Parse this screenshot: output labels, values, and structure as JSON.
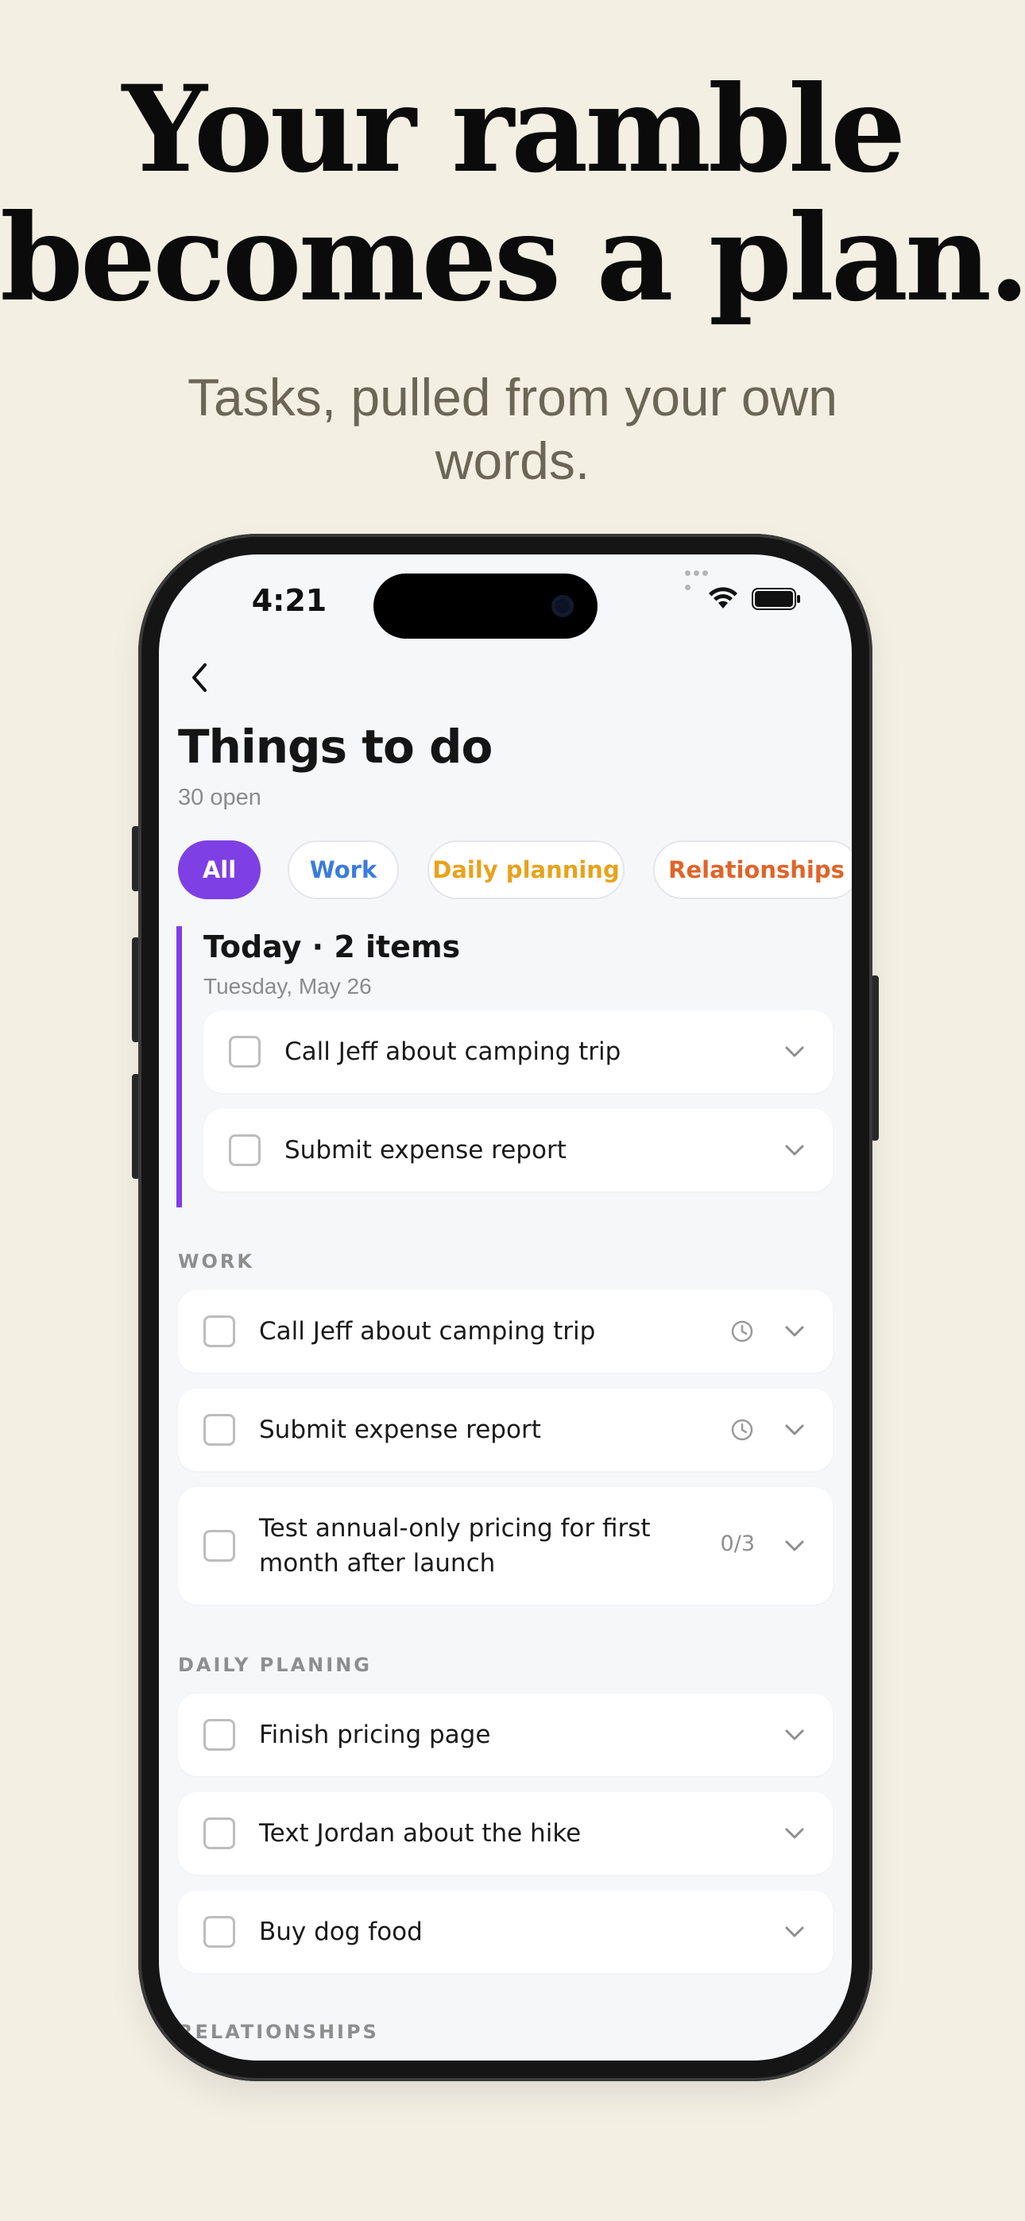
{
  "marketing": {
    "headline_line1": "Your ramble",
    "headline_line2": "becomes a plan.",
    "subhead_line1": "Tasks, pulled from your own",
    "subhead_line2": "words."
  },
  "status_bar": {
    "time": "4:21"
  },
  "screen": {
    "back_icon": "chevron-left-icon",
    "title": "Things to do",
    "open_count": "30 open"
  },
  "filters": [
    {
      "label": "All",
      "color": "#7E3FE5",
      "active": true
    },
    {
      "label": "Work",
      "color": "#3B7BE0",
      "active": false
    },
    {
      "label": "Daily planning",
      "color": "#E8A21C",
      "active": false
    },
    {
      "label": "Relationships",
      "color": "#E0642A",
      "active": false
    }
  ],
  "today": {
    "title": "Today · 2 items",
    "date": "Tuesday, May 26",
    "accent": "#7E3FE5",
    "items": [
      {
        "text": "Call Jeff about camping trip"
      },
      {
        "text": "Submit expense report"
      }
    ]
  },
  "sections": [
    {
      "label": "WORK",
      "items": [
        {
          "text": "Call Jeff about camping trip",
          "icon": "clock-icon"
        },
        {
          "text": "Submit expense report",
          "icon": "clock-icon"
        },
        {
          "text_line1": "Test annual-only pricing for first",
          "text_line2": "month after launch",
          "progress": "0/3"
        }
      ]
    },
    {
      "label": "DAILY PLANING",
      "items": [
        {
          "text": "Finish pricing page"
        },
        {
          "text": "Text Jordan about the hike"
        },
        {
          "text": "Buy dog food"
        }
      ]
    },
    {
      "label": "RELATIONSHIPS",
      "items": []
    }
  ]
}
